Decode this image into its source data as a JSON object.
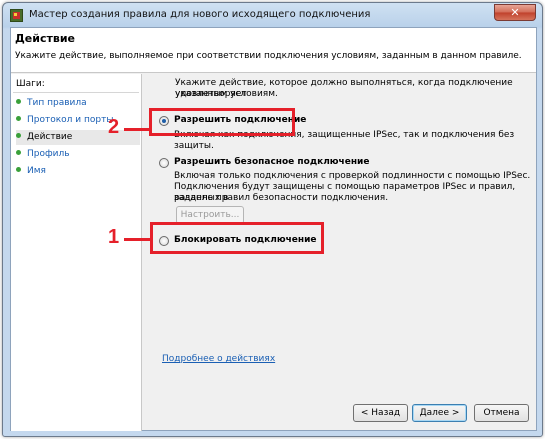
{
  "window": {
    "title": "Мастер создания правила для нового исходящего подключения",
    "close_glyph": "✕"
  },
  "header": {
    "title": "Действие",
    "description": "Укажите действие, выполняемое при соответствии подключения условиям, заданным в данном правиле."
  },
  "steps": {
    "label": "Шаги:",
    "items": [
      {
        "label": "Тип правила"
      },
      {
        "label": "Протокол и порты"
      },
      {
        "label": "Действие"
      },
      {
        "label": "Профиль"
      },
      {
        "label": "Имя"
      }
    ],
    "current": "Действие"
  },
  "main": {
    "intro_line1": "Укажите действие, которое должно выполняться, когда подключение удовлетворяет",
    "intro_line2": "указанным условиям.",
    "options": [
      {
        "label": "Разрешить подключение",
        "desc": [
          "Включая как подключения, защищенные IPSec, так и подключения без защиты."
        ],
        "checked": true
      },
      {
        "label": "Разрешить безопасное подключение",
        "desc": [
          "Включая только подключения с проверкой подлинности с помощью IPSec.",
          "Подключения будут защищены с помощью параметров IPSec и правил, заданных в",
          "разделе правил безопасности подключения."
        ],
        "checked": false
      },
      {
        "label": "Блокировать подключение",
        "desc": [],
        "checked": false
      }
    ],
    "customize_button": "Настроить...",
    "learn_more_link": "Подробнее о действиях"
  },
  "buttons": {
    "back": "< Назад",
    "next": "Далее >",
    "cancel": "Отмена"
  },
  "annotations": {
    "marker_1": "1",
    "marker_2": "2",
    "color": "#e5202a"
  }
}
